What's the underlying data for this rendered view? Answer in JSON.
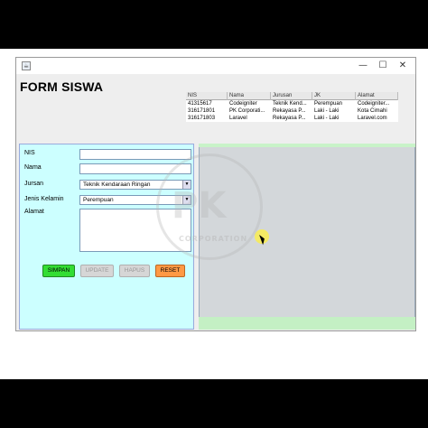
{
  "window": {
    "icon_glyph": "☕",
    "controls": {
      "minimize": "—",
      "maximize": "☐",
      "close": "✕"
    }
  },
  "form": {
    "title": "FORM SISWA",
    "labels": {
      "nis": "NIS",
      "nama": "Nama",
      "jurusan": "Jursan",
      "jenis_kelamin": "Jenis Kelamin",
      "alamat": "Alamat"
    },
    "values": {
      "nis": "",
      "nama": "",
      "jurusan": "Teknik Kendaraan Ringan",
      "jenis_kelamin": "Perempuan",
      "alamat": ""
    },
    "buttons": {
      "simpan": "SIMPAN",
      "update": "UPDATE",
      "hapus": "HAPUS",
      "reset": "RESET"
    }
  },
  "table": {
    "columns": [
      "NIS",
      "Nama",
      "Jurusan",
      "JK",
      "Alamat"
    ],
    "rows": [
      [
        "41315617",
        "Codeigniter",
        "Teknik Kend...",
        "Perempuan",
        "Codeigniter..."
      ],
      [
        "316171801",
        "PK Corporati...",
        "Rekayasa P...",
        "Laki - Laki",
        "Kota Cimahi"
      ],
      [
        "316171803",
        "Laravel",
        "Rekayasa P...",
        "Laki - Laki",
        "Laravel.com"
      ]
    ]
  },
  "watermark": {
    "text": "PK",
    "subtext": "CORPORATION"
  },
  "colors": {
    "left_panel": "#ccffff",
    "right_panel": "#d3d7da",
    "simpan": "#33dd33",
    "reset": "#ff9944",
    "accent_strip": "#c4f0c4"
  }
}
